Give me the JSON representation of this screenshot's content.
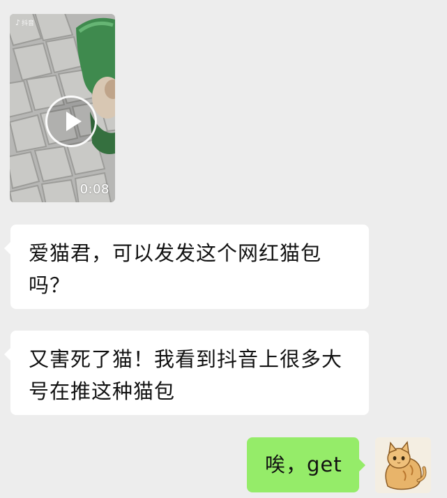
{
  "video": {
    "source_mark": "抖音",
    "source_icon": "music-note-icon",
    "duration": "0:08"
  },
  "messages": [
    {
      "direction": "incoming",
      "text": "爱猫君，可以发发这个网红猫包吗？"
    },
    {
      "direction": "incoming",
      "text": "又害死了猫！我看到抖音上很多大号在推这种猫包"
    },
    {
      "direction": "outgoing",
      "text": "唉，get"
    }
  ],
  "colors": {
    "chat_background": "#ededed",
    "incoming_bubble": "#ffffff",
    "outgoing_bubble": "#95ec69"
  }
}
